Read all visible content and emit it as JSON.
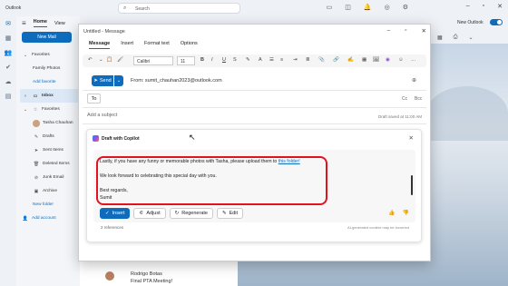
{
  "app": {
    "title": "Outlook"
  },
  "search": {
    "placeholder": "Search"
  },
  "nav": {
    "tabs": [
      "Home",
      "View"
    ],
    "new_mail": "New Mail",
    "favorites_top": "Favorites",
    "family_photos": "Family Photos",
    "add_favorite": "Add favorite",
    "inbox": "Inbox",
    "favorites": "Favorites",
    "tasha": "Tasha Chauhan",
    "drafts": "Drafts",
    "sent": "Sent Items",
    "deleted": "Deleted Items",
    "junk": "Junk Email",
    "archive": "Archive",
    "new_folder": "New folder",
    "add_account": "Add account"
  },
  "ribbon": {
    "new_outlook": "New Outlook"
  },
  "mail_item": {
    "sender": "Rodrigo Botas",
    "subject": "Final PTA Meeting!"
  },
  "compose": {
    "title": "Untitled - Message",
    "tabs": [
      "Message",
      "Insert",
      "Format text",
      "Options"
    ],
    "font": "Calibri",
    "size": "11",
    "send": "Send",
    "from": "From: sumit_chauhan2023@outlook.com",
    "to": "To",
    "cc": "Cc",
    "bcc": "Bcc",
    "subject_placeholder": "Add a subject",
    "draft_saved": "Draft saved at 11:00 AM"
  },
  "copilot": {
    "title": "Draft with Copilot",
    "line1_prefix": "Lastly, if you have any funny or memorable photos with Tasha, please upload them to ",
    "line1_link": "this folder!",
    "line2": "We look forward to celebrating this special day with you.",
    "line3": "Best regards,",
    "line4": "Sumit",
    "insert": "Insert",
    "adjust": "Adjust",
    "regenerate": "Regenerate",
    "edit": "Edit",
    "references": "2 references",
    "disclaimer": "AI-generated content may be incorrect"
  },
  "colors": {
    "accent": "#0f6cbd",
    "highlight": "#e3121f"
  }
}
